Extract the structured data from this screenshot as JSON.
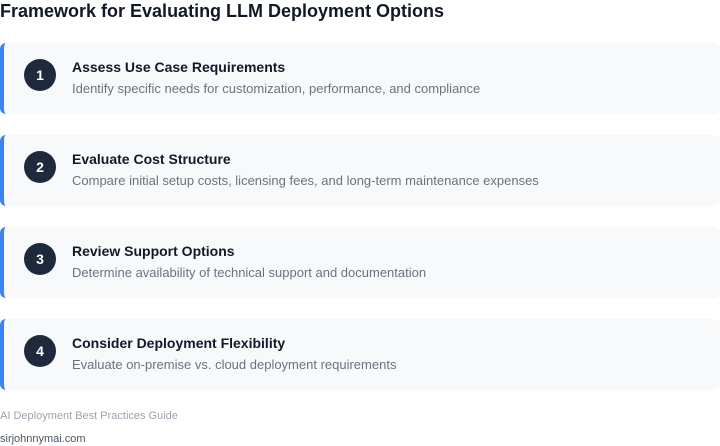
{
  "title": "Framework for Evaluating LLM Deployment Options",
  "steps": [
    {
      "number": "1",
      "title": "Assess Use Case Requirements",
      "description": "Identify specific needs for customization, performance, and compliance"
    },
    {
      "number": "2",
      "title": "Evaluate Cost Structure",
      "description": "Compare initial setup costs, licensing fees, and long-term maintenance expenses"
    },
    {
      "number": "3",
      "title": "Review Support Options",
      "description": "Determine availability of technical support and documentation"
    },
    {
      "number": "4",
      "title": "Consider Deployment Flexibility",
      "description": "Evaluate on-premise vs. cloud deployment requirements"
    }
  ],
  "footer": {
    "guide": "AI Deployment Best Practices Guide",
    "site": "sirjohnnymai.com"
  },
  "colors": {
    "accent": "#3b82f6",
    "badge": "#1e293b",
    "card_background": "#f8f9fb"
  }
}
